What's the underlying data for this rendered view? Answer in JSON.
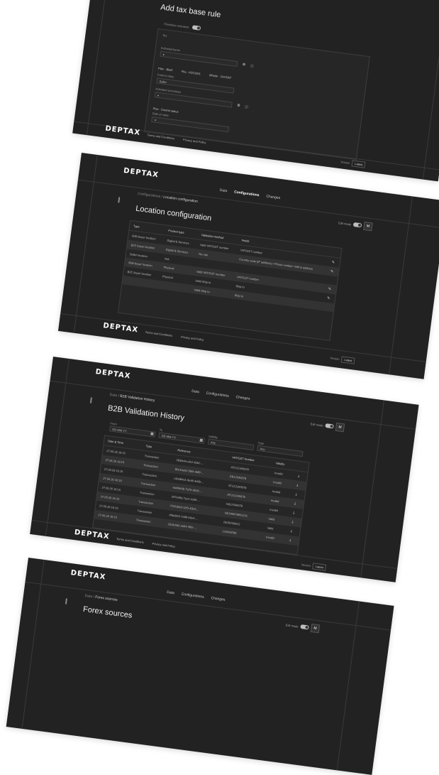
{
  "brand": {
    "logo_text": "DEPTAX"
  },
  "nav": {
    "data": "Data",
    "configurations": "Configurations",
    "changes": "Changes"
  },
  "common": {
    "edit_mode": "Edit mode",
    "avatar": "M",
    "terms": "Terms and Conditions",
    "privacy": "Privacy and Policy",
    "version_label": "Version",
    "version_value": "Latest"
  },
  "tax_rule": {
    "title": "Add tax base rule",
    "checkbox_label": "Checkbox activated",
    "tax_label": "Tax",
    "activated_items_label": "Activated items",
    "chips": [
      "Ptax · Bkd1",
      "Pku · KD12501",
      "Mhsdo · 2417007"
    ],
    "control_label": "Control value",
    "control_value": "Seller",
    "activated_values_label": "Activated (un)values",
    "chips2": [
      "Ptax · Control status"
    ],
    "date_label": "Date of order"
  },
  "location": {
    "breadcrumb_root": "Configurations",
    "breadcrumb_current": "Location configuration",
    "title": "Location configuration",
    "columns": [
      "Type",
      "Product type",
      "Validation method",
      "Fields"
    ],
    "rows": [
      [
        "B2B buyer location",
        "Digital & Services",
        "Valid VAT/GST number",
        "VAT/GST number"
      ],
      [
        "B2C buyer location",
        "Digital & Services",
        "No rule",
        "Country code (IP address) / Phone number / Bill to address"
      ],
      [
        "Seller location",
        "N/A",
        "",
        ""
      ],
      [
        "B2B buyer location",
        "Physical",
        "Valid VAT/GST number",
        "VAT/GST number"
      ],
      [
        "B2C buyer location",
        "Physical",
        "Valid Ship to",
        "Ship to"
      ],
      [
        "",
        "",
        "Valid Ship to",
        "Ship to"
      ]
    ]
  },
  "b2b": {
    "breadcrumb_root": "Data",
    "breadcrumb_current": "B2B Validation History",
    "title": "B2B Validation History",
    "filters": {
      "from_label": "From",
      "from_value": "DD-MM-YY",
      "to_label": "To",
      "to_value": "DD-MM-YY",
      "validity_label": "Validity",
      "validity_value": "Any",
      "type_label": "Type",
      "type_value": "Any"
    },
    "columns": [
      "Date & Time",
      "Type",
      "Reference",
      "VAT/GST Number",
      "Validity"
    ],
    "rows": [
      [
        "27.05.26 16:15",
        "Transaction",
        "283fa4a-efe2-4bb1-...",
        "ATU12345678",
        "Invalid"
      ],
      [
        "27.05.26 16:15",
        "Transaction",
        "80c4ae02-5bf4-4bf9-...",
        "GB12345678",
        "Invalid"
      ],
      [
        "27.05.26 16:15",
        "Transaction",
        "c4bd84a1-9e48-4a6b-...",
        "ATU12345678",
        "Invalid"
      ],
      [
        "27.05.26 16:15",
        "Transaction",
        "4a45fe0b-7a75-4b19-...",
        "ATU12345678",
        "Invalid"
      ],
      [
        "27.05.26 16:15",
        "Transaction",
        "297a45d-7ac2-4cb9-...",
        "GB12345678",
        "Invalid"
      ],
      [
        "27.05.26 16:15",
        "Transaction",
        "f7a51b6d-12f0-4304-...",
        "DE345678901231",
        "Valid"
      ],
      [
        "27.05.26 16:15",
        "Transaction",
        "4f9e6fe5-7a88-49e4-...",
        "DE56789012",
        "Valid"
      ],
      [
        "27.05.26 16:15",
        "Transaction",
        "2d1fe0d2-2a64-4f0e-...",
        "123456789",
        "Invalid"
      ]
    ]
  },
  "forex": {
    "breadcrumb_root": "Data",
    "breadcrumb_current": "Forex sources",
    "title": "Forex sources"
  }
}
